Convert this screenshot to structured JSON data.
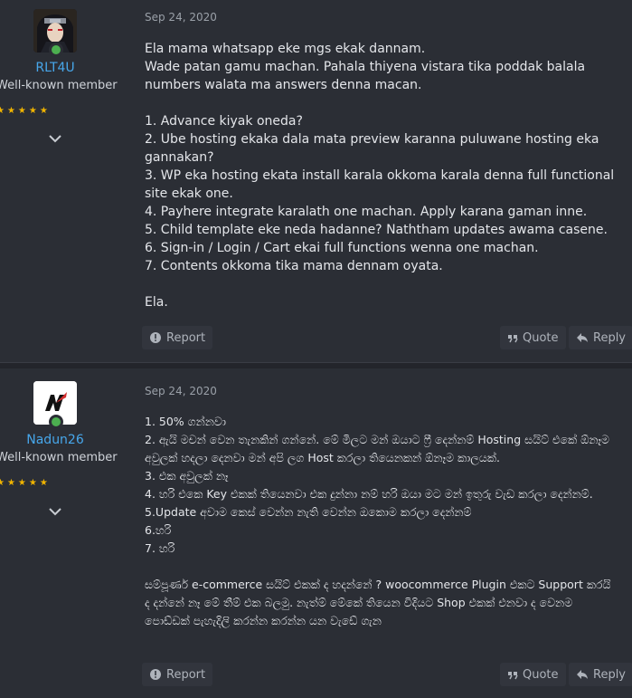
{
  "posts": [
    {
      "username": "RLT4U",
      "user_title": "Well-known member",
      "stars": "★★★★★",
      "date": "Sep 24, 2020",
      "lines": [
        "Ela mama whatsapp eke mgs ekak dannam.",
        "Wade patan gamu machan. Pahala thiyena vistara tika poddak balala numbers walata ma answers denna macan.",
        "",
        "1. Advance kiyak oneda?",
        "2. Ube hosting ekaka dala mata preview karanna puluwane hosting eka gannakan?",
        "3. WP eka hosting ekata install karala okkoma karala denna full functional site ekak one.",
        "4. Payhere integrate karalath one machan. Apply karana gaman inne.",
        "5. Child template eke neda hadanne? Naththam updates awama casene.",
        "6. Sign-in / Login / Cart ekai full functions wenna one machan.",
        "7. Contents okkoma tika mama dennam oyata.",
        "",
        "Ela."
      ],
      "report_label": "Report",
      "quote_label": "Quote",
      "reply_label": "Reply"
    },
    {
      "username": "Nadun26",
      "user_title": "Well-known member",
      "stars": "★★★★★",
      "date": "Sep 24, 2020",
      "lines": [
        "1. 50% ගන්නවා",
        "2. ඇයි මචන් වෙන තැනකින් ගන්නේ. මේ මිලට මන් ඔයාට ෆ්‍රී දෙන්නම් Hosting සයිට් එකේ ඕනෑම අවුලක් හදලා දෙනවා මන් අපි ලග Host කරලා තියෙනකන් ඕනෑම කාලයක්.",
        "3. එක අවුලක් නෑ",
        "4. හරි එකෙ Key එකක් තියෙනවා එක දුන්නා නම් හරි ඔයා මට මන් ඉතුරු වැඩ කරලා දෙන්නම්.",
        "5.Update අවාම කෙස් වෙන්න නැති වෙන්න ඔකොම කරලා දෙන්නම්",
        "6.හරි",
        "7. හරි",
        "",
        "සම්පූර්ණ e-commerce සයිට් එකක් ද හදන්නේ ? woocommerce Plugin එකට Support කරයි ද දන්නේ නෑ මේ තීම් එක බලමු. නැත්ම් මේකේ තියෙන විදියට Shop එකක් එනවා ද වෙනම පොඩ්ඩක් පැහැදිලි කරන්න කරන්න යන වැඩේ ගැන"
      ],
      "report_label": "Report",
      "quote_label": "Quote",
      "reply_label": "Reply"
    }
  ]
}
